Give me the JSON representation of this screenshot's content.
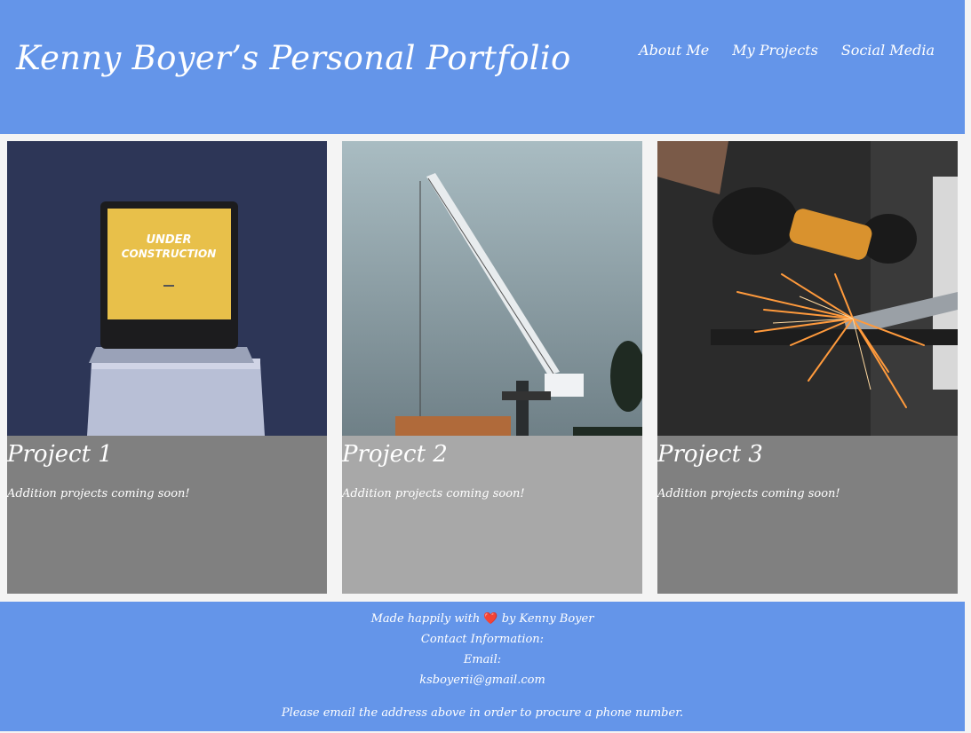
{
  "header": {
    "title": "Kenny Boyer’s Personal Portfolio",
    "nav": [
      "About Me",
      "My Projects",
      "Social Media"
    ]
  },
  "projects": [
    {
      "title": "Project 1",
      "text": "Addition projects coming soon!",
      "photo_text": [
        "UNDER",
        "CONSTRUCTION"
      ]
    },
    {
      "title": "Project 2",
      "text": "Addition projects coming soon!"
    },
    {
      "title": "Project 3",
      "text": "Addition projects coming soon!"
    }
  ],
  "footer": {
    "made_prefix": "Made happily with",
    "heart": "❤️",
    "made_suffix": "by Kenny Boyer",
    "contact_label": "Contact Information:",
    "email_label": "Email:",
    "email": "ksboyerii@gmail.com",
    "note": "Please email the address above in order to procure a phone number."
  },
  "colors": {
    "header_bg": "#6495e9",
    "card_dark": "#808080",
    "card_light": "#a8a8a8"
  }
}
